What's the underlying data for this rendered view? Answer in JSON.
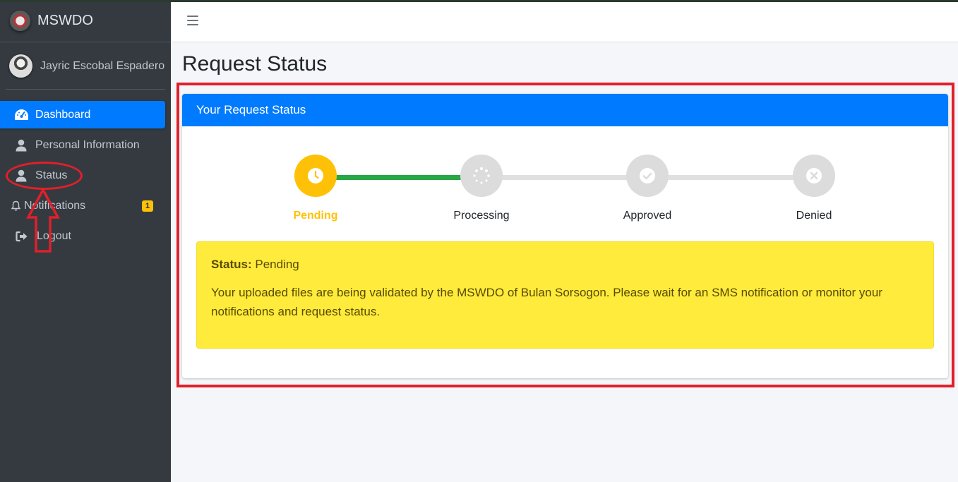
{
  "brand": {
    "name": "MSWDO"
  },
  "user": {
    "name": "Jayric Escobal Espadero"
  },
  "sidebar": {
    "items": [
      {
        "label": "Dashboard",
        "icon": "tachometer-icon",
        "active": true
      },
      {
        "label": "Personal Information",
        "icon": "user-icon"
      },
      {
        "label": "Status",
        "icon": "user-icon"
      },
      {
        "label": "Notifications",
        "icon": "bell-icon",
        "badge": "1"
      },
      {
        "label": "Logout",
        "icon": "sign-out-icon"
      }
    ]
  },
  "page": {
    "title": "Request Status"
  },
  "card": {
    "header": "Your Request Status",
    "steps": [
      {
        "label": "Pending",
        "state": "active",
        "icon": "clock-icon"
      },
      {
        "label": "Processing",
        "state": "inactive",
        "icon": "spinner-icon"
      },
      {
        "label": "Approved",
        "state": "inactive",
        "icon": "check-circle-icon"
      },
      {
        "label": "Denied",
        "state": "inactive",
        "icon": "times-circle-icon"
      }
    ],
    "alert": {
      "status_label": "Status:",
      "status_value": "Pending",
      "message": "Your uploaded files are being validated by the MSWDO of Bulan Sorsogon. Please wait for an SMS notification or monitor your notifications and request status."
    }
  },
  "colors": {
    "sidebar_bg": "#343a40",
    "primary": "#007bff",
    "warning": "#ffc107",
    "alert_bg": "#ffeb3b",
    "success": "#28a745",
    "annotation": "#e0202a"
  }
}
